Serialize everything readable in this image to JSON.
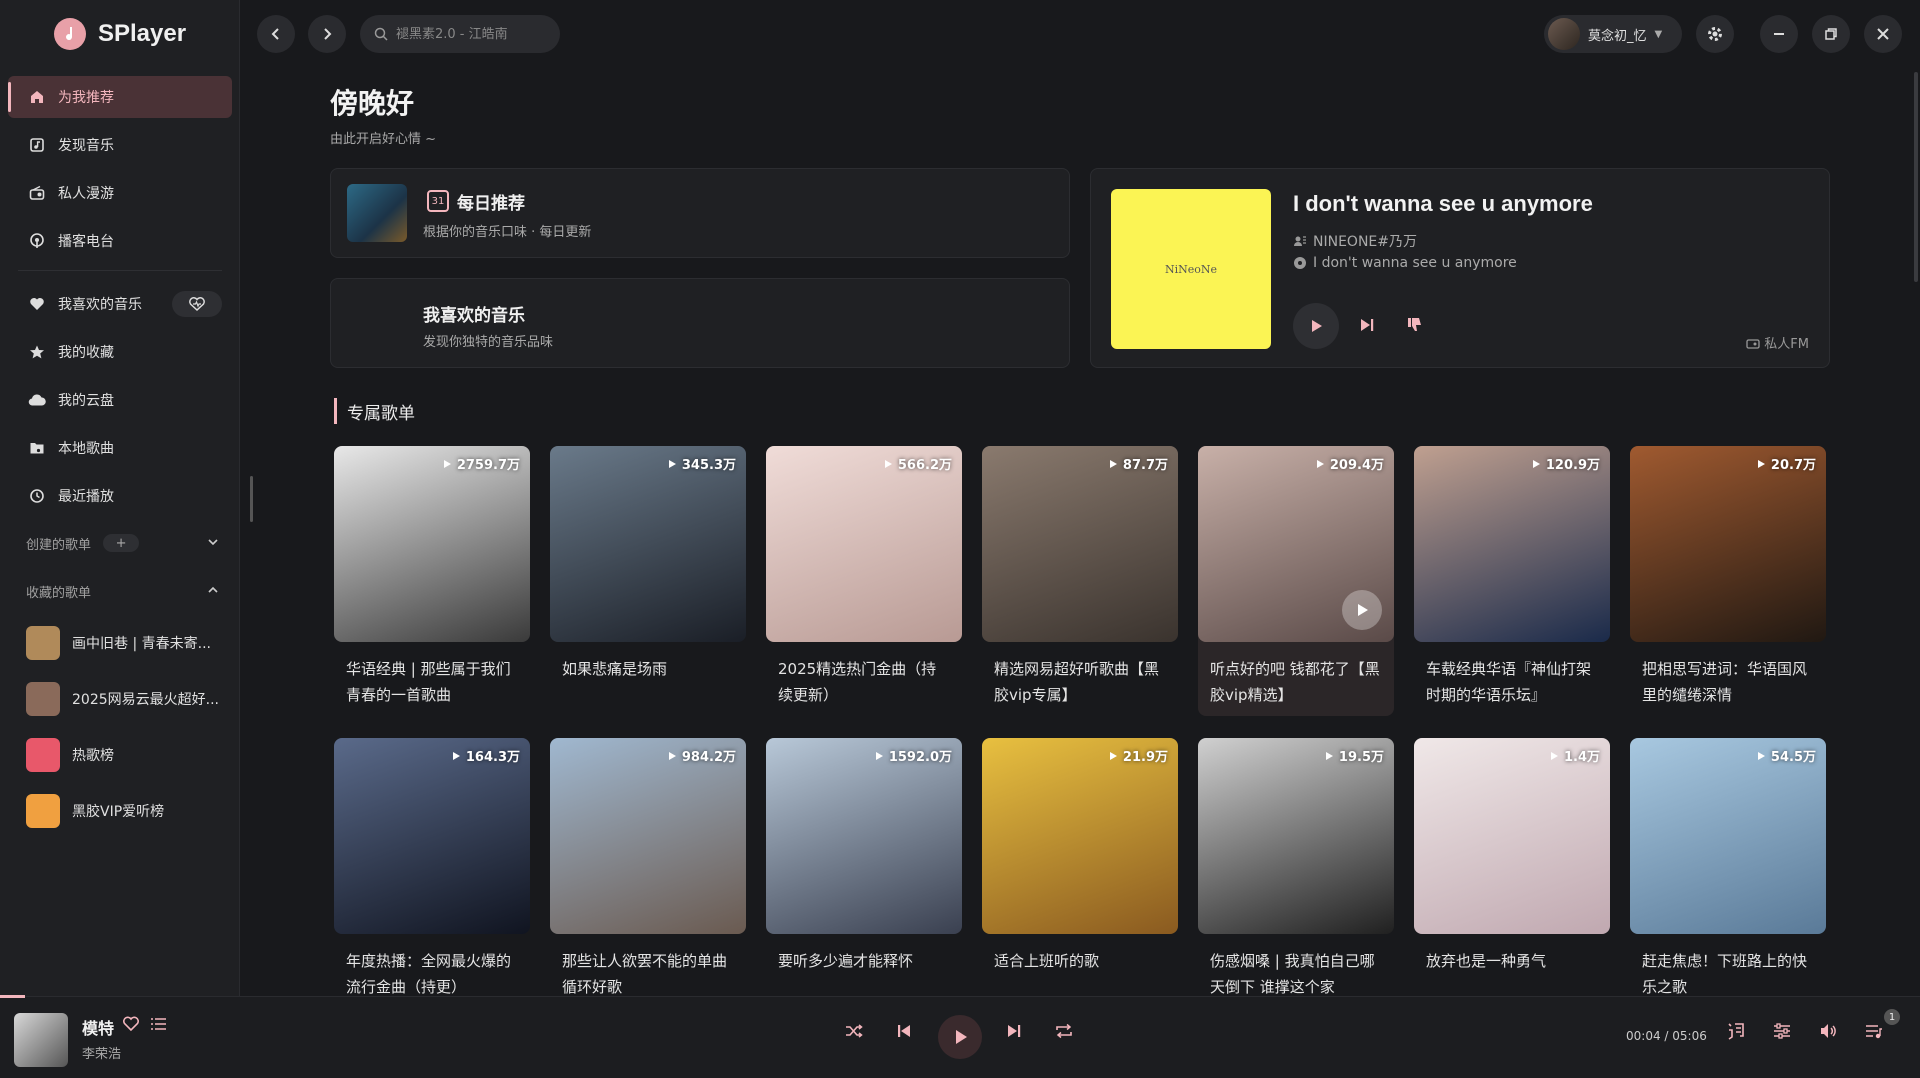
{
  "app": {
    "name": "SPlayer"
  },
  "search": {
    "placeholder": "褪黑素2.0 - 江皓南"
  },
  "user": {
    "name": "莫念初_忆"
  },
  "nav": {
    "items": [
      {
        "label": "为我推荐",
        "icon": "home-icon"
      },
      {
        "label": "发现音乐",
        "icon": "music-icon"
      },
      {
        "label": "私人漫游",
        "icon": "radio-icon"
      },
      {
        "label": "播客电台",
        "icon": "podcast-icon"
      }
    ],
    "library": [
      {
        "label": "我喜欢的音乐",
        "icon": "heart-icon"
      },
      {
        "label": "我的收藏",
        "icon": "star-icon"
      },
      {
        "label": "我的云盘",
        "icon": "cloud-icon"
      },
      {
        "label": "本地歌曲",
        "icon": "folder-music-icon"
      },
      {
        "label": "最近播放",
        "icon": "history-icon"
      }
    ],
    "created_label": "创建的歌单",
    "created_add": "+",
    "collected_label": "收藏的歌单",
    "collected": [
      {
        "label": "画中旧巷 | 青春未寄...",
        "color": "#b08a5a"
      },
      {
        "label": "2025网易云最火超好...",
        "color": "#8a6a5a"
      },
      {
        "label": "热歌榜",
        "color": "#e8586a"
      },
      {
        "label": "黑胶VIP爱听榜",
        "color": "#f0a040"
      }
    ]
  },
  "greeting": {
    "title": "傍晚好",
    "subtitle": "由此开启好心情 ~"
  },
  "daily": {
    "day": "31",
    "title": "每日推荐",
    "desc": "根据你的音乐口味 · 每日更新"
  },
  "liked": {
    "title": "我喜欢的音乐",
    "desc": "发现你独特的音乐品味"
  },
  "fm": {
    "cover_text": "NiNeoNe",
    "song": "I don't wanna see u anymore",
    "artist": "NINEONE#乃万",
    "album": "I don't wanna see u anymore",
    "tag": "私人FM"
  },
  "section": {
    "title": "专属歌单"
  },
  "playlists": [
    {
      "count": "2759.7万",
      "title": "华语经典 | 那些属于我们青春的一首歌曲",
      "c1": "#e8e8e8",
      "c2": "#3a3a3a"
    },
    {
      "count": "345.3万",
      "title": "如果悲痛是场雨",
      "c1": "#6a7a8a",
      "c2": "#1a1e26"
    },
    {
      "count": "566.2万",
      "title": "2025精选热门金曲（持续更新）",
      "c1": "#f0dcd8",
      "c2": "#b89a94"
    },
    {
      "count": "87.7万",
      "title": "精选网易超好听歌曲【黑胶vip专属】",
      "c1": "#8a7a6e",
      "c2": "#3a332e"
    },
    {
      "count": "209.4万",
      "title": "听点好的吧 钱都花了【黑胶vip精选】",
      "c1": "#c8b0a8",
      "c2": "#5a4a48"
    },
    {
      "count": "120.9万",
      "title": "车载经典华语『神仙打架时期的华语乐坛』",
      "c1": "#c0a090",
      "c2": "#1a2a4a"
    },
    {
      "count": "20.7万",
      "title": "把相思写进词：华语国风里的缱绻深情",
      "c1": "#a05a30",
      "c2": "#201812"
    },
    {
      "count": "164.3万",
      "title": "年度热播：全网最火爆的流行金曲（持更）",
      "c1": "#5a6a8a",
      "c2": "#101420"
    },
    {
      "count": "984.2万",
      "title": "那些让人欲罢不能的单曲循环好歌",
      "c1": "#a0b8d0",
      "c2": "#6a5a50"
    },
    {
      "count": "1592.0万",
      "title": "要听多少遍才能释怀",
      "c1": "#b8c8d8",
      "c2": "#3a4050"
    },
    {
      "count": "21.9万",
      "title": "适合上班听的歌",
      "c1": "#e8c040",
      "c2": "#8a5a20"
    },
    {
      "count": "19.5万",
      "title": "伤感烟嗓 | 我真怕自己哪天倒下 谁撑这个家",
      "c1": "#d0d0d0",
      "c2": "#202020"
    },
    {
      "count": "1.4万",
      "title": "放弃也是一种勇气",
      "c1": "#f0e8e8",
      "c2": "#c0a8b0"
    },
    {
      "count": "54.5万",
      "title": "赶走焦虑！下班路上的快乐之歌",
      "c1": "#a8c8e0",
      "c2": "#5a7a98"
    }
  ],
  "player": {
    "title": "模特",
    "artist": "李荣浩",
    "time": "00:04 / 05:06",
    "progress": 0.013,
    "queue_count": "1"
  }
}
